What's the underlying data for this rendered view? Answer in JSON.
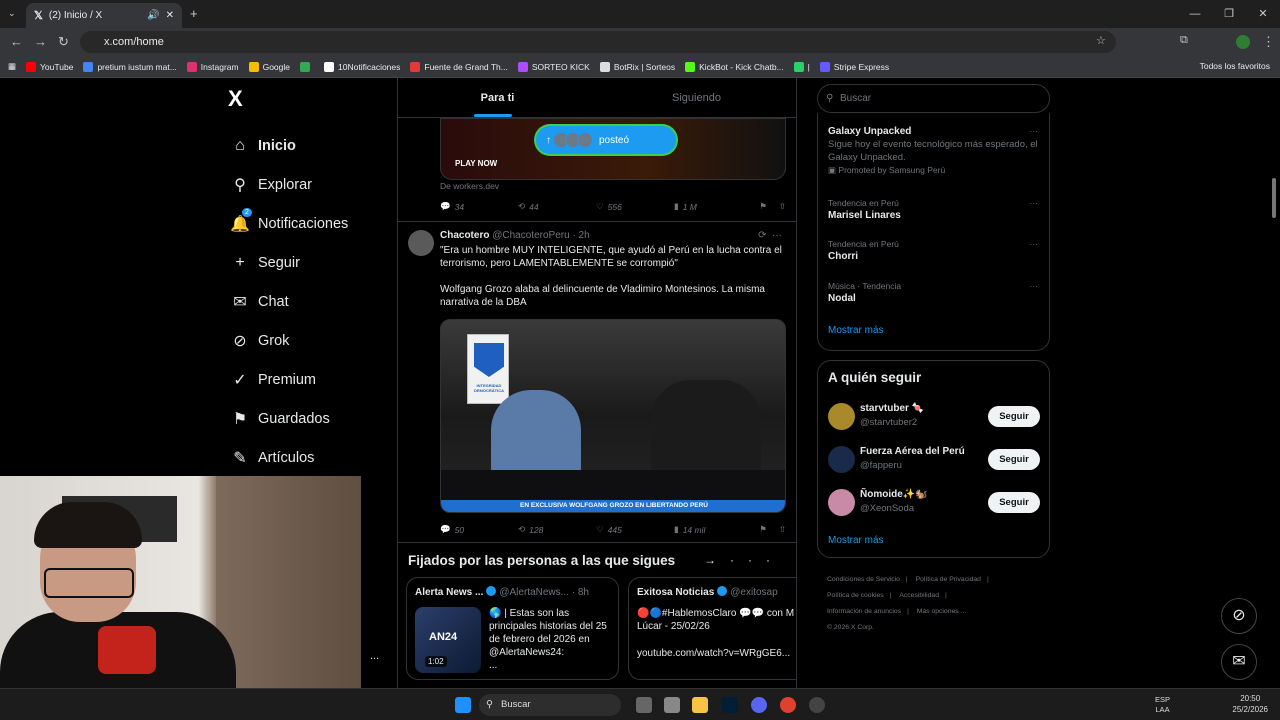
{
  "browser": {
    "tab_title": "(2) Inicio / X",
    "url": "x.com/home",
    "bookmarks": [
      {
        "label": "YouTube",
        "color": "#ff0000"
      },
      {
        "label": "pretium iustum mat...",
        "color": "#4285f4"
      },
      {
        "label": "Instagram",
        "color": "#e1306c"
      },
      {
        "label": "Google",
        "color": "#fbbc05"
      },
      {
        "label": "",
        "color": "#34a853"
      },
      {
        "label": "10Notificaciones",
        "color": "#ffffff"
      },
      {
        "label": "Fuente de Grand Th...",
        "color": "#e53935"
      },
      {
        "label": "SORTEO KICK",
        "color": "#b04cff"
      },
      {
        "label": "BotRix | Sorteos",
        "color": "#dddddd"
      },
      {
        "label": "KickBot - Kick Chatb...",
        "color": "#53fc18"
      },
      {
        "label": "|",
        "color": "#25d366"
      },
      {
        "label": "Stripe Express",
        "color": "#635bff"
      }
    ],
    "all_bookmarks": "Todos los favoritos"
  },
  "nav": {
    "logo": "X",
    "items": [
      {
        "label": "Inicio",
        "icon": "⌂"
      },
      {
        "label": "Explorar",
        "icon": "⚲"
      },
      {
        "label": "Notificaciones",
        "icon": "🔔",
        "badge": "2"
      },
      {
        "label": "Seguir",
        "icon": "+"
      },
      {
        "label": "Chat",
        "icon": "✉"
      },
      {
        "label": "Grok",
        "icon": "⊘"
      },
      {
        "label": "Premium",
        "icon": "✓"
      },
      {
        "label": "Guardados",
        "icon": "⚑"
      },
      {
        "label": "Artículos",
        "icon": "✎"
      }
    ],
    "more": "..."
  },
  "feed": {
    "tabs": [
      "Para ti",
      "Siguiendo"
    ],
    "ad": {
      "play_now": "PLAY NOW",
      "source": "De workers.dev",
      "posted_pill": "posteó",
      "replies": "34",
      "reposts": "44",
      "likes": "556",
      "views": "1 M"
    },
    "tweet": {
      "author": "Chacotero",
      "handle": "@ChacoteroPeru",
      "time": "· 2h",
      "text1": "\"Era un hombre MUY INTELIGENTE, que ayudó al Perú en la lucha contra el terrorismo, pero LAMENTABLEMENTE se corrompió\"",
      "text2": "Wolfgang Grozo alaba al delincuente de Vladimiro Montesinos. La misma narrativa de la DBA",
      "media_caption": "EN EXCLUSIVA WOLFGANG GROZO EN LIBERTANDO PERÚ",
      "sign_text": "INTEGRIDAD DEMOCRÁTICA",
      "replies": "50",
      "reposts": "128",
      "likes": "445",
      "views": "14 mil"
    },
    "pinned": {
      "title": "Fijados por las personas a las que sigues",
      "cards": [
        {
          "author": "Alerta News ...",
          "handle": "@AlertaNews...",
          "time": "· 8h",
          "thumb_label": "AN24",
          "duration": "1:02",
          "text": "| Estas son las principales historias del 25 de febrero del 2026 en @AlertaNews24:",
          "ellipsis": "..."
        },
        {
          "author": "Exitosa Noticias",
          "handle": "@exitosap",
          "text": "#HablemosClaro 💬💬 con M Lúcar - 25/02/26",
          "link": "youtube.com/watch?v=WRgGE6..."
        }
      ]
    }
  },
  "sidebar": {
    "search_placeholder": "Buscar",
    "trends": [
      {
        "context": "",
        "title": "Galaxy Unpacked",
        "desc": "Sigue hoy el evento tecnológico más esperado, el Galaxy Unpacked.",
        "promo": "Promoted by Samsung Perú"
      },
      {
        "context": "Tendencia en Perú",
        "title": "Marisel Linares"
      },
      {
        "context": "Tendencia en Perú",
        "title": "Chorri"
      },
      {
        "context": "Música · Tendencia",
        "title": "Nodal"
      }
    ],
    "show_more": "Mostrar más",
    "who_to_follow": "A quién seguir",
    "follow": [
      {
        "name": "starvtuber 🍬",
        "handle": "@starvtuber2",
        "color": "#a88a2a"
      },
      {
        "name": "Fuerza Aérea del Perú",
        "handle": "@fapperu",
        "color": "#1a2a4a"
      },
      {
        "name": "Ñomoide✨🐿️",
        "handle": "@XeonSoda",
        "color": "#c98aa8"
      }
    ],
    "follow_btn": "Seguir",
    "show_more_2": "Mostrar más",
    "footer": [
      "Condiciones de Servicio",
      "Política de Privacidad",
      "Política de cookies",
      "Accesibilidad",
      "Información de anuncios",
      "Más opciones ...",
      "© 2026 X Corp."
    ]
  },
  "taskbar": {
    "search": "Buscar",
    "lang1": "ESP",
    "lang2": "LAA",
    "time": "20:50",
    "date": "25/2/2026"
  }
}
